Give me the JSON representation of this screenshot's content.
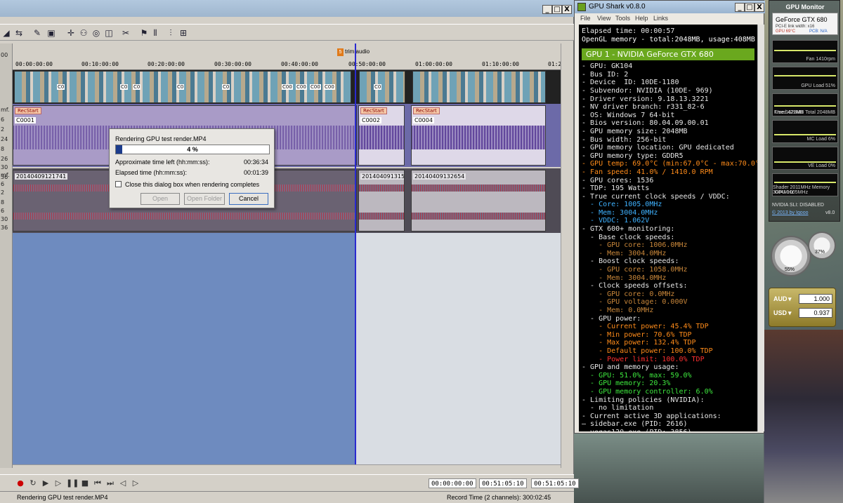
{
  "vegas": {
    "title_buttons": [
      "_",
      "□",
      "X"
    ],
    "ruler_marks": [
      "00:00:00:00",
      "00:10:00:00",
      "00:20:00:00",
      "00:30:00:00",
      "00:40:00:00",
      "00:50:00:00",
      "01:00:00:00",
      "01:10:00:00",
      "01:20"
    ],
    "marker_num": "5",
    "marker_label": "trim audio",
    "track_labels": [
      "00",
      "mf.",
      "6",
      "2",
      "24",
      "8",
      "26",
      "30",
      "36",
      "mf.",
      "6",
      "2",
      "8",
      "6",
      "30",
      "36"
    ],
    "video_captions": [
      "C0",
      "C0",
      "C0",
      "C0",
      "C0",
      "C00",
      "C00",
      "C00",
      "C00",
      "C0"
    ],
    "audio1_clips": [
      {
        "tag": "RecStart",
        "name": "C0001"
      },
      {
        "tag": "RecStart",
        "name": "C0002"
      },
      {
        "tag": "RecStart",
        "name": "C0004"
      }
    ],
    "audio2_clips": [
      "20140409121741",
      "20140409131516",
      "20140409132654"
    ],
    "time_codes": [
      "00:00:00:00",
      "00:51:05:10",
      "00:51:05:10"
    ],
    "status_left": "Rendering GPU test render.MP4",
    "status_right": "Record Time (2 channels): 300:02:45"
  },
  "render_dialog": {
    "title": "Rendering GPU test render.MP4",
    "progress_percent": 4,
    "progress_label": "4 %",
    "time_left_label": "Approximate time left (hh:mm:ss):",
    "time_left_value": "00:36:34",
    "elapsed_label": "Elapsed time (hh:mm:ss):",
    "elapsed_value": "00:01:39",
    "checkbox_label": "Close this dialog box when rendering completes",
    "open_label": "Open",
    "open_folder_label": "Open Folder",
    "cancel_label": "Cancel"
  },
  "gpu_shark": {
    "title": "GPU Shark v0.8.0",
    "menu": [
      "File",
      "View",
      "Tools",
      "Help",
      "Links"
    ],
    "gpu_header": "GPU 1 - NVIDIA GeForce GTX 680",
    "lines_top": [
      {
        "text": "Elapsed time: 00:00:57",
        "color": "#e8e8e8"
      },
      {
        "text": "OpenGL memory - total:2048MB, usage:408MB",
        "color": "#ffffff"
      }
    ],
    "lines": [
      {
        "text": "- GPU: GK104",
        "color": "#e8e8e8"
      },
      {
        "text": "- Bus ID: 2",
        "color": "#e8e8e8"
      },
      {
        "text": "- Device  ID: 10DE-1180",
        "color": "#e8e8e8"
      },
      {
        "text": "- Subvendor: NVIDIA (10DE- 969)",
        "color": "#e8e8e8"
      },
      {
        "text": "- Driver version: 9.18.13.3221",
        "color": "#e8e8e8"
      },
      {
        "text": "- NV driver branch: r331_82-6",
        "color": "#e8e8e8"
      },
      {
        "text": "- OS: Windows 7 64-bit",
        "color": "#e8e8e8"
      },
      {
        "text": "- Bios version: 80.04.09.00.01",
        "color": "#e8e8e8"
      },
      {
        "text": "- GPU memory size: 2048MB",
        "color": "#e8e8e8"
      },
      {
        "text": "- Bus width: 256-bit",
        "color": "#e8e8e8"
      },
      {
        "text": "- GPU memory location: GPU dedicated",
        "color": "#e8e8e8"
      },
      {
        "text": "- GPU memory type: GDDR5",
        "color": "#e8e8e8"
      },
      {
        "text": "- GPU temp: 69.0°C (min:67.0°C - max:70.0°C)",
        "color": "#ff8c1a"
      },
      {
        "text": "- Fan speed: 41.0% / 1410.0 RPM",
        "color": "#ff8c1a"
      },
      {
        "text": "- GPU cores: 1536",
        "color": "#e8e8e8"
      },
      {
        "text": "- TDP: 195 Watts",
        "color": "#e8e8e8"
      },
      {
        "text": "- True current clock speeds / VDDC:",
        "color": "#e8e8e8"
      },
      {
        "text": "  - Core: 1005.0MHz",
        "color": "#3fb2ff"
      },
      {
        "text": "  - Mem: 3004.0MHz",
        "color": "#3fb2ff"
      },
      {
        "text": "  - VDDC: 1.062V",
        "color": "#3fb2ff"
      },
      {
        "text": "- GTX 600+ monitoring:",
        "color": "#e8e8e8"
      },
      {
        "text": "  - Base clock speeds:",
        "color": "#e8e8e8"
      },
      {
        "text": "    - GPU core: 1006.0MHz",
        "color": "#c9873a"
      },
      {
        "text": "    - Mem: 3004.0MHz",
        "color": "#c9873a"
      },
      {
        "text": "  - Boost clock speeds:",
        "color": "#e8e8e8"
      },
      {
        "text": "    - GPU core: 1058.0MHz",
        "color": "#c9873a"
      },
      {
        "text": "    - Mem: 3004.0MHz",
        "color": "#c9873a"
      },
      {
        "text": "  - Clock speeds offsets:",
        "color": "#e8e8e8"
      },
      {
        "text": "    - GPU core: 0.0MHz",
        "color": "#c9873a"
      },
      {
        "text": "    - GPU voltage: 0.000V",
        "color": "#c9873a"
      },
      {
        "text": "    - Mem: 0.0MHz",
        "color": "#c9873a"
      },
      {
        "text": "  - GPU power:",
        "color": "#e8e8e8"
      },
      {
        "text": "    - Current power: 45.4% TDP",
        "color": "#ff8c1a"
      },
      {
        "text": "    - Min power: 70.6% TDP",
        "color": "#ff8c1a"
      },
      {
        "text": "    - Max power: 132.4% TDP",
        "color": "#ff8c1a"
      },
      {
        "text": "    - Default power: 100.0% TDP",
        "color": "#ff8c1a"
      },
      {
        "text": "    - Power limit: 100.0% TDP",
        "color": "#ff3030"
      },
      {
        "text": "- GPU and memory usage:",
        "color": "#e8e8e8"
      },
      {
        "text": "  - GPU: 51.0%, max: 59.0%",
        "color": "#3ee83e"
      },
      {
        "text": "  - GPU memory: 20.3%",
        "color": "#3ee83e"
      },
      {
        "text": "  - GPU memory controller: 6.0%",
        "color": "#3ee83e"
      },
      {
        "text": "- Limiting policies (NVIDIA):",
        "color": "#e8e8e8"
      },
      {
        "text": "  - no limitation",
        "color": "#e8e8e8"
      },
      {
        "text": "- Current active 3D applications:",
        "color": "#e8e8e8"
      },
      {
        "text": "— sidebar.exe (PID: 2616)",
        "color": "#e8e8e8"
      },
      {
        "text": "— vegas120.exe (PID: 3856)",
        "color": "#e8e8e8"
      }
    ]
  },
  "gpu_monitor": {
    "title": "GPU Monitor",
    "model": "GeForce GTX 680",
    "sub": "PCI-E link width: x16",
    "sub2_left": "GPU 69°C",
    "sub2_right": "PCB: N/A",
    "panels": [
      {
        "left": "",
        "right": "Fan 1410rpm",
        "level": 0.41
      },
      {
        "left": "",
        "right": "GPU Load 51%",
        "level": 0.51
      },
      {
        "left": "Used 421MB",
        "right": "Free 1628MB Total 2048MB",
        "level": 0.21
      },
      {
        "left": "",
        "right": "MC Load 6%",
        "level": 0.06
      },
      {
        "left": "",
        "right": "VE Load 0%",
        "level": 0.0
      },
      {
        "left": "GPU 1005MHz",
        "right": "Shader 2011MHz Memory 3004MHz",
        "level": 0.5
      }
    ],
    "sli": "NVIDIA SLI: DISABLED",
    "copyright": "© 2013 by Iqooo",
    "version": "v8.0"
  },
  "gauges": {
    "left_value": "55%",
    "right_value": "37%"
  },
  "currency": [
    {
      "code": "AUD",
      "value": "1.000"
    },
    {
      "code": "USD",
      "value": "0.937"
    }
  ]
}
